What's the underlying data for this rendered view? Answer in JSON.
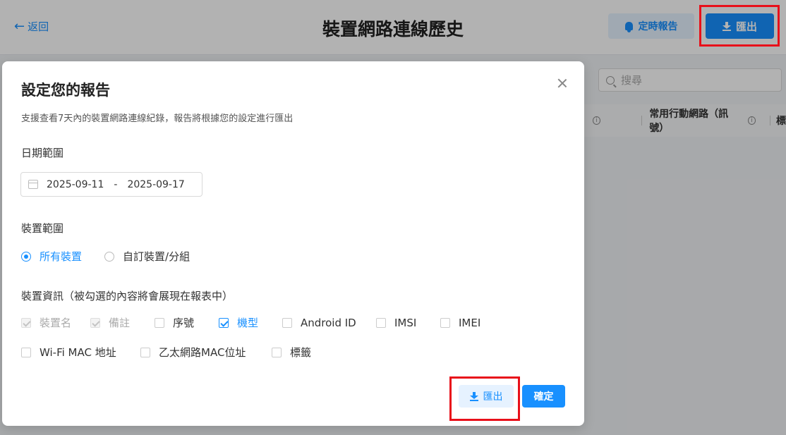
{
  "header": {
    "back_label": "返回",
    "title": "裝置網路連線歷史",
    "schedule_label": "定時報告",
    "export_label": "匯出"
  },
  "background": {
    "search_placeholder": "搜尋",
    "column_mobile": "常用行動網路（訊號）",
    "column_next": "標"
  },
  "modal": {
    "title": "設定您的報告",
    "description": "支援查看7天內的裝置網路連線紀錄，報告將根據您的設定進行匯出",
    "date_label": "日期範圍",
    "date_start": "2025-09-11",
    "date_separator": "-",
    "date_end": "2025-09-17",
    "device_scope_label": "裝置範圍",
    "scope_options": [
      {
        "label": "所有裝置",
        "selected": true
      },
      {
        "label": "自訂裝置/分組",
        "selected": false
      }
    ],
    "info_label": "裝置資訊（被勾選的內容將會展現在報表中）",
    "checkboxes_row1": [
      {
        "label": "裝置名",
        "checked": true,
        "disabled": true
      },
      {
        "label": "備註",
        "checked": true,
        "disabled": true
      },
      {
        "label": "序號",
        "checked": false,
        "disabled": false
      },
      {
        "label": "機型",
        "checked": true,
        "disabled": false
      },
      {
        "label": "Android ID",
        "checked": false,
        "disabled": false
      },
      {
        "label": "IMSI",
        "checked": false,
        "disabled": false
      },
      {
        "label": "IMEI",
        "checked": false,
        "disabled": false
      }
    ],
    "checkboxes_row2": [
      {
        "label": "Wi-Fi MAC 地址",
        "checked": false,
        "disabled": false
      },
      {
        "label": "乙太網路MAC位址",
        "checked": false,
        "disabled": false
      },
      {
        "label": "標籤",
        "checked": false,
        "disabled": false
      }
    ],
    "export_label": "匯出",
    "confirm_label": "確定"
  },
  "colors": {
    "accent": "#1890ff",
    "highlight": "#e8101a"
  },
  "icons": [
    "arrow-left-icon",
    "bell-icon",
    "download-icon",
    "search-icon",
    "info-icon",
    "close-icon",
    "calendar-icon"
  ]
}
